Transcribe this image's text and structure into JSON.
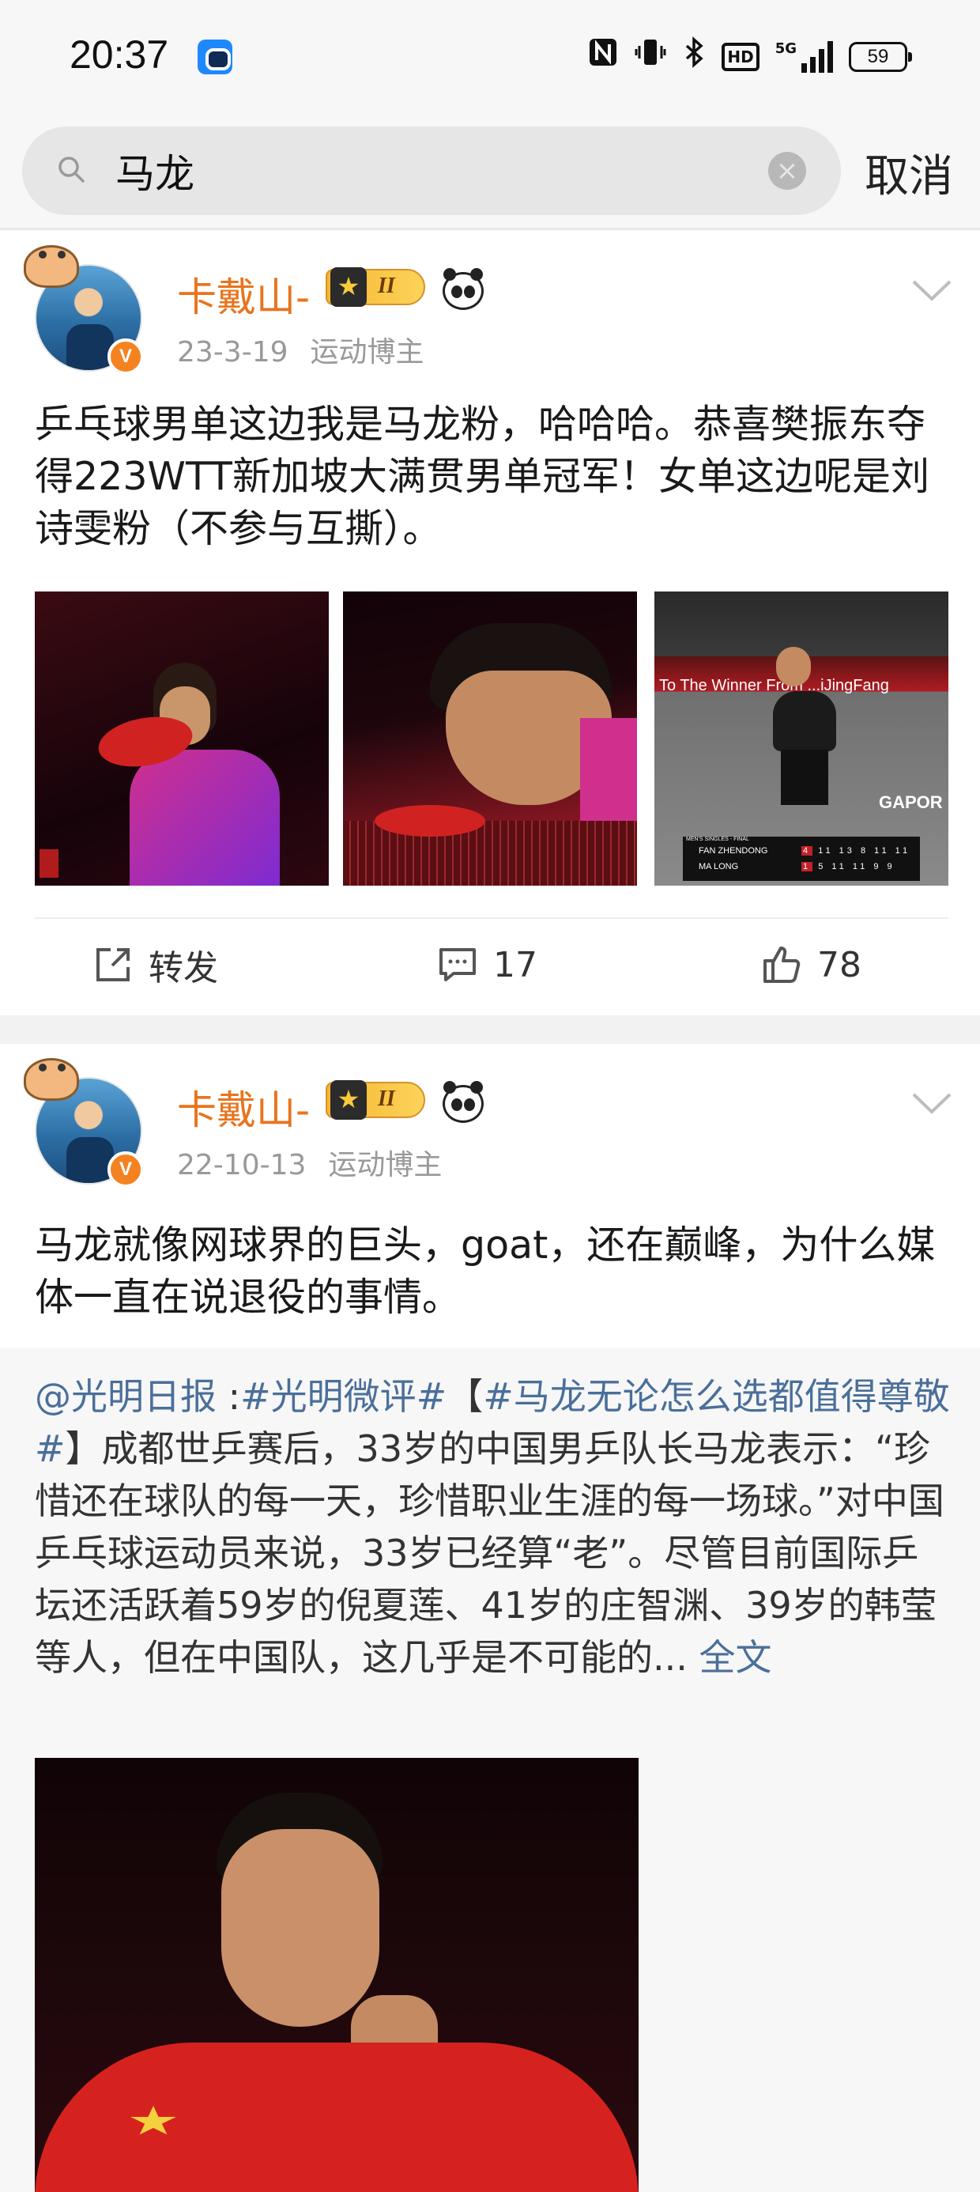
{
  "status_bar": {
    "time": "20:37",
    "net_type": "5G",
    "hd": "HD",
    "battery": "59",
    "icons": [
      "nfc-icon",
      "vibrate-icon",
      "bluetooth-icon",
      "hd-icon",
      "signal-icon",
      "battery-icon"
    ]
  },
  "search": {
    "query": "马龙",
    "cancel_label": "取消"
  },
  "posts": [
    {
      "username": "卡戴山-",
      "vip_level": "II",
      "date": "23-3-19",
      "tag": "运动博主",
      "text": "乒乓球男单这边我是马龙粉，哈哈哈。恭喜樊振东夺得223WTT新加坡大满贯男单冠军！女单这边呢是刘诗雯粉（不参与互撕）。",
      "images": [
        {
          "desc": "ma-long-holding-paddle"
        },
        {
          "desc": "ma-long-closeup"
        },
        {
          "desc": "final-scoreboard",
          "banner": "To The Winner From ...iJingFang",
          "ad": "GAPOR",
          "board_title": "MEN'S SINGLES - FINAL",
          "players": [
            "FAN ZHENDONG",
            "MA LONG"
          ],
          "scores": [
            [
              "4",
              "11",
              "13",
              "8",
              "11",
              "11"
            ],
            [
              "1",
              "5",
              "11",
              "11",
              "9",
              "9"
            ]
          ]
        }
      ],
      "actions": {
        "repost_label": "转发",
        "comment_count": "17",
        "like_count": "78"
      }
    },
    {
      "username": "卡戴山-",
      "vip_level": "II",
      "date": "22-10-13",
      "tag": "运动博主",
      "text": "马龙就像网球界的巨头，goat，还在巅峰，为什么媒体一直在说退役的事情。",
      "retweet": {
        "mention": "@光明日报",
        "sep": " :",
        "hashtag1": "#光明微评#",
        "bracket_open": "【",
        "hashtag2": "#马龙无论怎么选都值得尊敬#",
        "body": "】成都世乒赛后，33岁的中国男乒队长马龙表示：“珍惜还在球队的每一天，珍惜职业生涯的每一场球。”对中国乒乓球运动员来说，33岁已经算“老”。尽管目前国际乒坛还活跃着59岁的倪夏莲、41岁的庄智渊、39岁的韩莹等人，但在中国队，这几乎是不可能的...",
        "full_text_label": "全文"
      }
    }
  ],
  "colors": {
    "username": "#e8741d",
    "link": "#4a6f9a",
    "verified": "#f58220"
  }
}
